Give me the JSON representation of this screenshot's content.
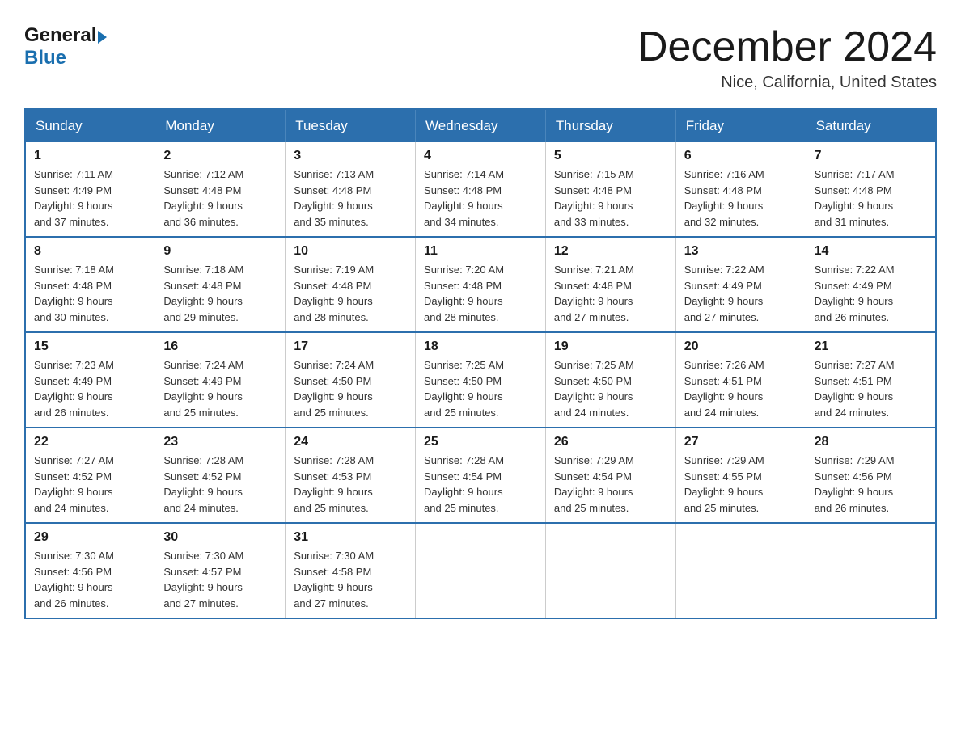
{
  "header": {
    "logo_general": "General",
    "logo_blue": "Blue",
    "title": "December 2024",
    "subtitle": "Nice, California, United States"
  },
  "calendar": {
    "days_of_week": [
      "Sunday",
      "Monday",
      "Tuesday",
      "Wednesday",
      "Thursday",
      "Friday",
      "Saturday"
    ],
    "weeks": [
      [
        {
          "day": "1",
          "sunrise": "7:11 AM",
          "sunset": "4:49 PM",
          "daylight": "9 hours and 37 minutes."
        },
        {
          "day": "2",
          "sunrise": "7:12 AM",
          "sunset": "4:48 PM",
          "daylight": "9 hours and 36 minutes."
        },
        {
          "day": "3",
          "sunrise": "7:13 AM",
          "sunset": "4:48 PM",
          "daylight": "9 hours and 35 minutes."
        },
        {
          "day": "4",
          "sunrise": "7:14 AM",
          "sunset": "4:48 PM",
          "daylight": "9 hours and 34 minutes."
        },
        {
          "day": "5",
          "sunrise": "7:15 AM",
          "sunset": "4:48 PM",
          "daylight": "9 hours and 33 minutes."
        },
        {
          "day": "6",
          "sunrise": "7:16 AM",
          "sunset": "4:48 PM",
          "daylight": "9 hours and 32 minutes."
        },
        {
          "day": "7",
          "sunrise": "7:17 AM",
          "sunset": "4:48 PM",
          "daylight": "9 hours and 31 minutes."
        }
      ],
      [
        {
          "day": "8",
          "sunrise": "7:18 AM",
          "sunset": "4:48 PM",
          "daylight": "9 hours and 30 minutes."
        },
        {
          "day": "9",
          "sunrise": "7:18 AM",
          "sunset": "4:48 PM",
          "daylight": "9 hours and 29 minutes."
        },
        {
          "day": "10",
          "sunrise": "7:19 AM",
          "sunset": "4:48 PM",
          "daylight": "9 hours and 28 minutes."
        },
        {
          "day": "11",
          "sunrise": "7:20 AM",
          "sunset": "4:48 PM",
          "daylight": "9 hours and 28 minutes."
        },
        {
          "day": "12",
          "sunrise": "7:21 AM",
          "sunset": "4:48 PM",
          "daylight": "9 hours and 27 minutes."
        },
        {
          "day": "13",
          "sunrise": "7:22 AM",
          "sunset": "4:49 PM",
          "daylight": "9 hours and 27 minutes."
        },
        {
          "day": "14",
          "sunrise": "7:22 AM",
          "sunset": "4:49 PM",
          "daylight": "9 hours and 26 minutes."
        }
      ],
      [
        {
          "day": "15",
          "sunrise": "7:23 AM",
          "sunset": "4:49 PM",
          "daylight": "9 hours and 26 minutes."
        },
        {
          "day": "16",
          "sunrise": "7:24 AM",
          "sunset": "4:49 PM",
          "daylight": "9 hours and 25 minutes."
        },
        {
          "day": "17",
          "sunrise": "7:24 AM",
          "sunset": "4:50 PM",
          "daylight": "9 hours and 25 minutes."
        },
        {
          "day": "18",
          "sunrise": "7:25 AM",
          "sunset": "4:50 PM",
          "daylight": "9 hours and 25 minutes."
        },
        {
          "day": "19",
          "sunrise": "7:25 AM",
          "sunset": "4:50 PM",
          "daylight": "9 hours and 24 minutes."
        },
        {
          "day": "20",
          "sunrise": "7:26 AM",
          "sunset": "4:51 PM",
          "daylight": "9 hours and 24 minutes."
        },
        {
          "day": "21",
          "sunrise": "7:27 AM",
          "sunset": "4:51 PM",
          "daylight": "9 hours and 24 minutes."
        }
      ],
      [
        {
          "day": "22",
          "sunrise": "7:27 AM",
          "sunset": "4:52 PM",
          "daylight": "9 hours and 24 minutes."
        },
        {
          "day": "23",
          "sunrise": "7:28 AM",
          "sunset": "4:52 PM",
          "daylight": "9 hours and 24 minutes."
        },
        {
          "day": "24",
          "sunrise": "7:28 AM",
          "sunset": "4:53 PM",
          "daylight": "9 hours and 25 minutes."
        },
        {
          "day": "25",
          "sunrise": "7:28 AM",
          "sunset": "4:54 PM",
          "daylight": "9 hours and 25 minutes."
        },
        {
          "day": "26",
          "sunrise": "7:29 AM",
          "sunset": "4:54 PM",
          "daylight": "9 hours and 25 minutes."
        },
        {
          "day": "27",
          "sunrise": "7:29 AM",
          "sunset": "4:55 PM",
          "daylight": "9 hours and 25 minutes."
        },
        {
          "day": "28",
          "sunrise": "7:29 AM",
          "sunset": "4:56 PM",
          "daylight": "9 hours and 26 minutes."
        }
      ],
      [
        {
          "day": "29",
          "sunrise": "7:30 AM",
          "sunset": "4:56 PM",
          "daylight": "9 hours and 26 minutes."
        },
        {
          "day": "30",
          "sunrise": "7:30 AM",
          "sunset": "4:57 PM",
          "daylight": "9 hours and 27 minutes."
        },
        {
          "day": "31",
          "sunrise": "7:30 AM",
          "sunset": "4:58 PM",
          "daylight": "9 hours and 27 minutes."
        },
        null,
        null,
        null,
        null
      ]
    ],
    "sunrise_label": "Sunrise:",
    "sunset_label": "Sunset:",
    "daylight_label": "Daylight:"
  }
}
